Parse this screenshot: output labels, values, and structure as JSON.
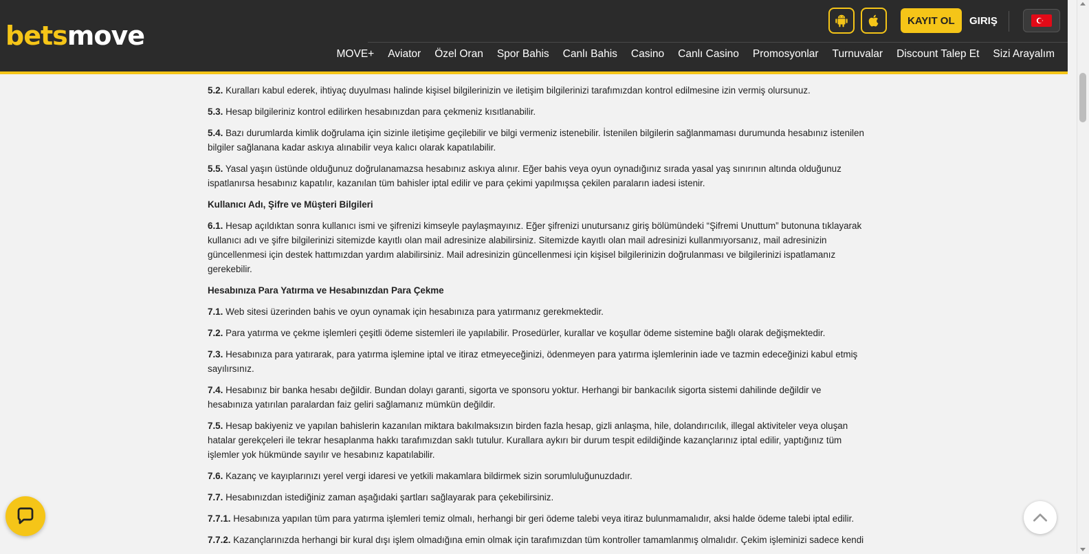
{
  "header": {
    "logo": {
      "part1": "bets",
      "part2": "move"
    },
    "register_label": "KAYIT OL",
    "login_label": "GIRIŞ",
    "nav": [
      "MOVE+",
      "Aviator",
      "Özel Oran",
      "Spor Bahis",
      "Canlı Bahis",
      "Casino",
      "Canlı Casino",
      "Promosyonlar",
      "Turnuvalar",
      "Discount Talep Et",
      "Sizi Arayalım"
    ]
  },
  "colors": {
    "accent": "#f5c518",
    "header_bg": "#2b2b2b",
    "page_bg": "#f2f2f2"
  },
  "content": {
    "blocks": [
      {
        "num": "5.2.",
        "text": "Kuralları kabul ederek, ihtiyaç duyulması halinde kişisel bilgilerinizin ve iletişim bilgilerinizi tarafımızdan kontrol edilmesine izin vermiş olursunuz."
      },
      {
        "num": "5.3.",
        "text": "Hesap bilgileriniz kontrol edilirken hesabınızdan para çekmeniz kısıtlanabilir."
      },
      {
        "num": "5.4.",
        "text": "Bazı durumlarda kimlik doğrulama için sizinle iletişime geçilebilir ve bilgi vermeniz istenebilir. İstenilen bilgilerin sağlanmaması durumunda hesabınız istenilen bilgiler sağlanana kadar askıya alınabilir veya kalıcı olarak kapatılabilir."
      },
      {
        "num": "5.5.",
        "text": "Yasal yaşın üstünde olduğunuz doğrulanamazsa hesabınız askıya alınır. Eğer bahis veya oyun oynadığınız sırada yasal yaş sınırının altında olduğunuz ispatlanırsa hesabınız kapatılır, kazanılan tüm bahisler iptal edilir ve para çekimi yapılmışsa çekilen paraların iadesi istenir."
      },
      {
        "heading": "Kullanıcı Adı, Şifre ve Müşteri Bilgileri"
      },
      {
        "num": "6.1.",
        "text": "Hesap açıldıktan sonra kullanıcı ismi ve şifrenizi kimseyle paylaşmayınız. Eğer şifrenizi unutursanız giriş bölümündeki “Şifremi Unuttum” butonuna tıklayarak kullanıcı adı ve şifre bilgilerinizi sitemizde kayıtlı olan mail adresinize alabilirsiniz. Sitemizde kayıtlı olan mail adresinizi kullanmıyorsanız, mail adresinizin güncellenmesi için destek hattımızdan yardım alabilirsiniz. Mail adresinizin güncellenmesi için kişisel bilgilerinizin doğrulanması ve bilgilerinizi ispatlamanız gerekebilir."
      },
      {
        "heading": "Hesabınıza Para Yatırma ve Hesabınızdan Para Çekme"
      },
      {
        "num": "7.1.",
        "text": "Web sitesi üzerinden bahis ve oyun oynamak için hesabınıza para yatırmanız gerekmektedir."
      },
      {
        "num": "7.2.",
        "text": "Para yatırma ve çekme işlemleri çeşitli ödeme sistemleri ile yapılabilir. Prosedürler, kurallar ve koşullar ödeme sistemine bağlı olarak değişmektedir."
      },
      {
        "num": "7.3.",
        "text": "Hesabınıza para yatırarak, para yatırma işlemine iptal ve itiraz etmeyeceğinizi, ödenmeyen para yatırma işlemlerinin iade ve tazmin edeceğinizi kabul etmiş sayılırsınız."
      },
      {
        "num": "7.4.",
        "text": "Hesabınız bir banka hesabı değildir. Bundan dolayı garanti, sigorta ve sponsoru yoktur. Herhangi bir bankacılık sigorta sistemi dahilinde değildir ve hesabınıza yatırılan paralardan faiz geliri sağlamanız mümkün değildir."
      },
      {
        "num": "7.5.",
        "text": "Hesap bakiyeniz ve yapılan bahislerin kazanılan miktara bakılmaksızın birden fazla hesap, gizli anlaşma, hile, dolandırıcılık, illegal aktiviteler veya oluşan hatalar gerekçeleri ile tekrar hesaplanma hakkı tarafımızdan saklı tutulur. Kurallara aykırı bir durum tespit edildiğinde kazançlarınız iptal edilir, yaptığınız tüm işlemler yok hükmünde sayılır ve hesabınız kapatılabilir."
      },
      {
        "num": "7.6.",
        "text": "Kazanç ve kayıplarınızı yerel vergi idaresi ve yetkili makamlara bildirmek sizin sorumluluğunuzdadır."
      },
      {
        "num": "7.7.",
        "text": "Hesabınızdan istediğiniz zaman aşağıdaki şartları sağlayarak para çekebilirsiniz."
      },
      {
        "num": "7.7.1.",
        "text": "Hesabınıza yapılan tüm para yatırma işlemleri temiz olmalı, herhangi bir geri ödeme talebi veya itiraz bulunmamalıdır, aksi halde ödeme talebi iptal edilir."
      },
      {
        "num": "7.7.2.",
        "text": "Kazançlarınızda herhangi bir kural dışı işlem olmadığına emin olmak için tarafımızdan tüm kontroller tamamlanmış olmalıdır. Çekim işleminizi sadece kendi"
      }
    ]
  },
  "icons": {
    "android": "android-icon",
    "apple": "apple-icon",
    "flag": "turkey-flag-icon",
    "chat": "chat-icon",
    "top": "chevron-up-icon"
  }
}
